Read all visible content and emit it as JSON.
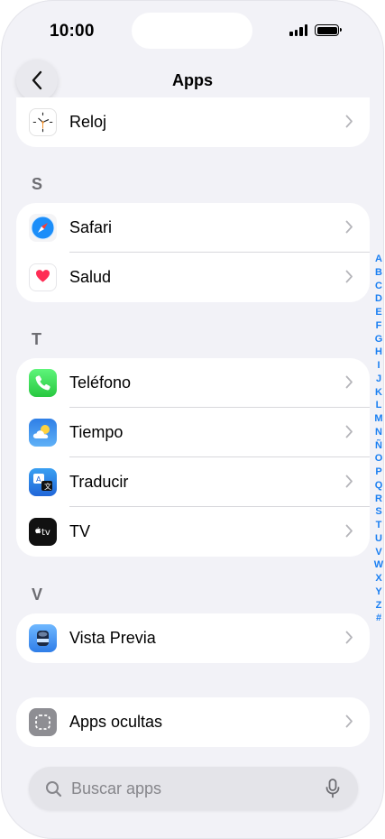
{
  "status_bar": {
    "time": "10:00"
  },
  "nav": {
    "title": "Apps",
    "back_icon": "chevron-left-icon"
  },
  "top_row": {
    "label": "Reloj",
    "icon": "clock-app-icon"
  },
  "sections": {
    "s": {
      "letter": "S",
      "items": [
        {
          "label": "Safari",
          "icon": "safari-app-icon"
        },
        {
          "label": "Salud",
          "icon": "health-app-icon"
        }
      ]
    },
    "t": {
      "letter": "T",
      "items": [
        {
          "label": "Teléfono",
          "icon": "phone-app-icon"
        },
        {
          "label": "Tiempo",
          "icon": "weather-app-icon"
        },
        {
          "label": "Traducir",
          "icon": "translate-app-icon"
        },
        {
          "label": "TV",
          "icon": "tv-app-icon"
        }
      ]
    },
    "v": {
      "letter": "V",
      "items": [
        {
          "label": "Vista Previa",
          "icon": "preview-app-icon"
        }
      ]
    }
  },
  "hidden_apps": {
    "label": "Apps ocultas",
    "icon": "hidden-apps-icon"
  },
  "index_letters": [
    "A",
    "B",
    "C",
    "D",
    "E",
    "F",
    "G",
    "H",
    "I",
    "J",
    "K",
    "L",
    "M",
    "N",
    "Ñ",
    "O",
    "P",
    "Q",
    "R",
    "S",
    "T",
    "U",
    "V",
    "W",
    "X",
    "Y",
    "Z",
    "#"
  ],
  "search": {
    "placeholder": "Buscar apps",
    "value": ""
  },
  "colors": {
    "accent": "#1a7ff2",
    "background": "#f2f2f7",
    "separator": "#d8d8dc"
  }
}
